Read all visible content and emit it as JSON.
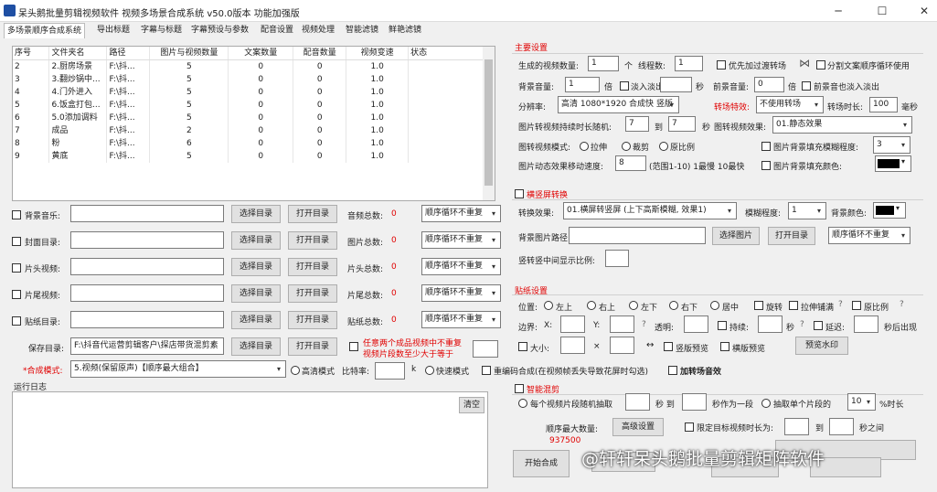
{
  "title": "呆头鹅批量剪辑视频软件    视频多场景合成系统   v50.0版本  功能加强版",
  "tabs": [
    "多场景顺序合成系统",
    "导出标题",
    "字幕与标题",
    "字幕预设与参数",
    "配音设置",
    "视频处理",
    "智能滤镜",
    "鲜艳滤镜"
  ],
  "table": {
    "headers": [
      "序号",
      "文件夹名",
      "路径",
      "图片与视频数量",
      "文案数量",
      "配音数量",
      "视频变速",
      "状态"
    ],
    "rows": [
      [
        "2",
        "2.厨房场景",
        "F:\\抖...",
        "5",
        "0",
        "0",
        "1.0",
        ""
      ],
      [
        "3",
        "3.翻炒锅中...",
        "F:\\抖...",
        "5",
        "0",
        "0",
        "1.0",
        ""
      ],
      [
        "4",
        "4.门外进入",
        "F:\\抖...",
        "5",
        "0",
        "0",
        "1.0",
        ""
      ],
      [
        "5",
        "6.饭盒打包...",
        "F:\\抖...",
        "5",
        "0",
        "0",
        "1.0",
        ""
      ],
      [
        "6",
        "5.0添加调料",
        "F:\\抖...",
        "5",
        "0",
        "0",
        "1.0",
        ""
      ],
      [
        "7",
        "成品",
        "F:\\抖...",
        "2",
        "0",
        "0",
        "1.0",
        ""
      ],
      [
        "8",
        "粉",
        "F:\\抖...",
        "6",
        "0",
        "0",
        "1.0",
        ""
      ],
      [
        "9",
        "黄底",
        "F:\\抖...",
        "5",
        "0",
        "0",
        "1.0",
        ""
      ]
    ]
  },
  "media_rows": [
    {
      "label": "背景音乐:",
      "count_label": "音频总数:",
      "count": "0",
      "mode": "顺序循环不重复"
    },
    {
      "label": "封面目录:",
      "count_label": "图片总数:",
      "count": "0",
      "mode": "顺序循环不重复"
    },
    {
      "label": "片头视频:",
      "count_label": "片头总数:",
      "count": "0",
      "mode": "顺序循环不重复"
    },
    {
      "label": "片尾视频:",
      "count_label": "片尾总数:",
      "count": "0",
      "mode": "顺序循环不重复"
    },
    {
      "label": "贴纸目录:",
      "count_label": "贴纸总数:",
      "count": "0",
      "mode": "顺序循环不重复"
    }
  ],
  "buttons": {
    "choose_dir": "选择目录",
    "open_dir": "打开目录",
    "clear": "清空",
    "choose_img": "选择图片",
    "open_dir2": "打开目录",
    "preview_wm": "预览水印",
    "advanced": "高级设置",
    "start": "开始合成"
  },
  "save": {
    "label": "保存目录:",
    "path": "F:\\抖音代运营剪辑客户\\探店带货混剪素",
    "warn1": "任意两个成品视频中不重复",
    "warn2": "视频片段数至少大于等于"
  },
  "compose": {
    "label": "*合成模式:",
    "mode": "5.视频(保留原声)【顺序最大组合】",
    "hq": "高清模式",
    "bitrate": "比特率:",
    "k": "k",
    "fast": "快速模式",
    "reencode": "重编码合成(在视频帧丢失导致花屏时勾选)",
    "transition_sfx": "加转场音效"
  },
  "log_label": "运行日志",
  "main": {
    "header": "主要设置",
    "gen_count_label": "生成的视频数量:",
    "gen_count": "1",
    "unit_ge": "个",
    "threads_label": "线程数:",
    "threads": "1",
    "prefer_filter": "优先加过渡转场",
    "split_copy": "分割文案顺序循环使用",
    "bg_vol_label": "背景音量:",
    "bg_vol": "1",
    "bei": "倍",
    "fade_label": "淡入淡出",
    "sec": "秒",
    "fg_vol_label": "前景音量:",
    "fg_vol": "0",
    "fg_fade": "前景音也淡入淡出",
    "res_label": "分辨率:",
    "res": "高清 1080*1920 合成快 竖版",
    "trans_label": "转场特效:",
    "trans": "不使用转场",
    "trans_dur_label": "转场时长:",
    "trans_dur": "100",
    "ms": "毫秒",
    "img_dur_label": "图片转视频持续时长随机:",
    "img_min": "7",
    "to": "到",
    "img_max": "7",
    "img_sec": "秒",
    "img_effect_label": "图转视频效果:",
    "img_effect": "01.静态效果",
    "img_mode_label": "图转视频模式:",
    "stretch": "拉伸",
    "crop": "裁剪",
    "orig": "原比例",
    "blur_label": "图片背景填充模糊程度:",
    "blur": "3",
    "speed_label": "图片动态效果移动速度:",
    "speed": "8",
    "speed_hint": "(范围1-10) 1最慢 10最快",
    "fill_color_label": "图片背景填充颜色:"
  },
  "landscape": {
    "header": "横竖屏转换",
    "effect_label": "转换效果:",
    "effect": "01.横屏转竖屏 (上下高斯模糊, 效果1)",
    "blur_label": "模糊程度:",
    "blur": "1",
    "bg_color_label": "背景颜色:",
    "bg_img_label": "背景图片路径:",
    "mode": "顺序循环不重复",
    "ratio_label": "竖转竖中间显示比例:"
  },
  "sticker": {
    "header": "贴纸设置",
    "pos_label": "位置:",
    "positions": [
      "左上",
      "右上",
      "左下",
      "右下",
      "居中"
    ],
    "rotate": "旋转",
    "stretch": "拉伸铺满",
    "orig": "原比例",
    "margin_label": "边界:",
    "x": "X:",
    "y": "Y:",
    "opacity": "透明:",
    "duration": "持续:",
    "sec": "秒",
    "delay": "延迟:",
    "after": "秒后出现",
    "size": "大小:",
    "x2": "×",
    "preview_sticker": "竖版预览",
    "landscape_preview": "横版预览"
  },
  "smart": {
    "header": "智能混剪",
    "every_label": "每个视频片段随机抽取",
    "sec_to": "秒 到",
    "sec_seg": "秒作为一段",
    "single_label": "抽取单个片段的",
    "pct": "10",
    "pct_unit": "%时长",
    "max_label": "顺序最大数量:",
    "max_value": "937500",
    "limit": "限定目标视频时长为:",
    "to2": "到",
    "range": "秒之间"
  },
  "watermark": "@轩轩呆头鹅批量剪辑矩阵软件",
  "colors": {
    "accent_red": "#e00000",
    "black_swatch": "#000000"
  }
}
